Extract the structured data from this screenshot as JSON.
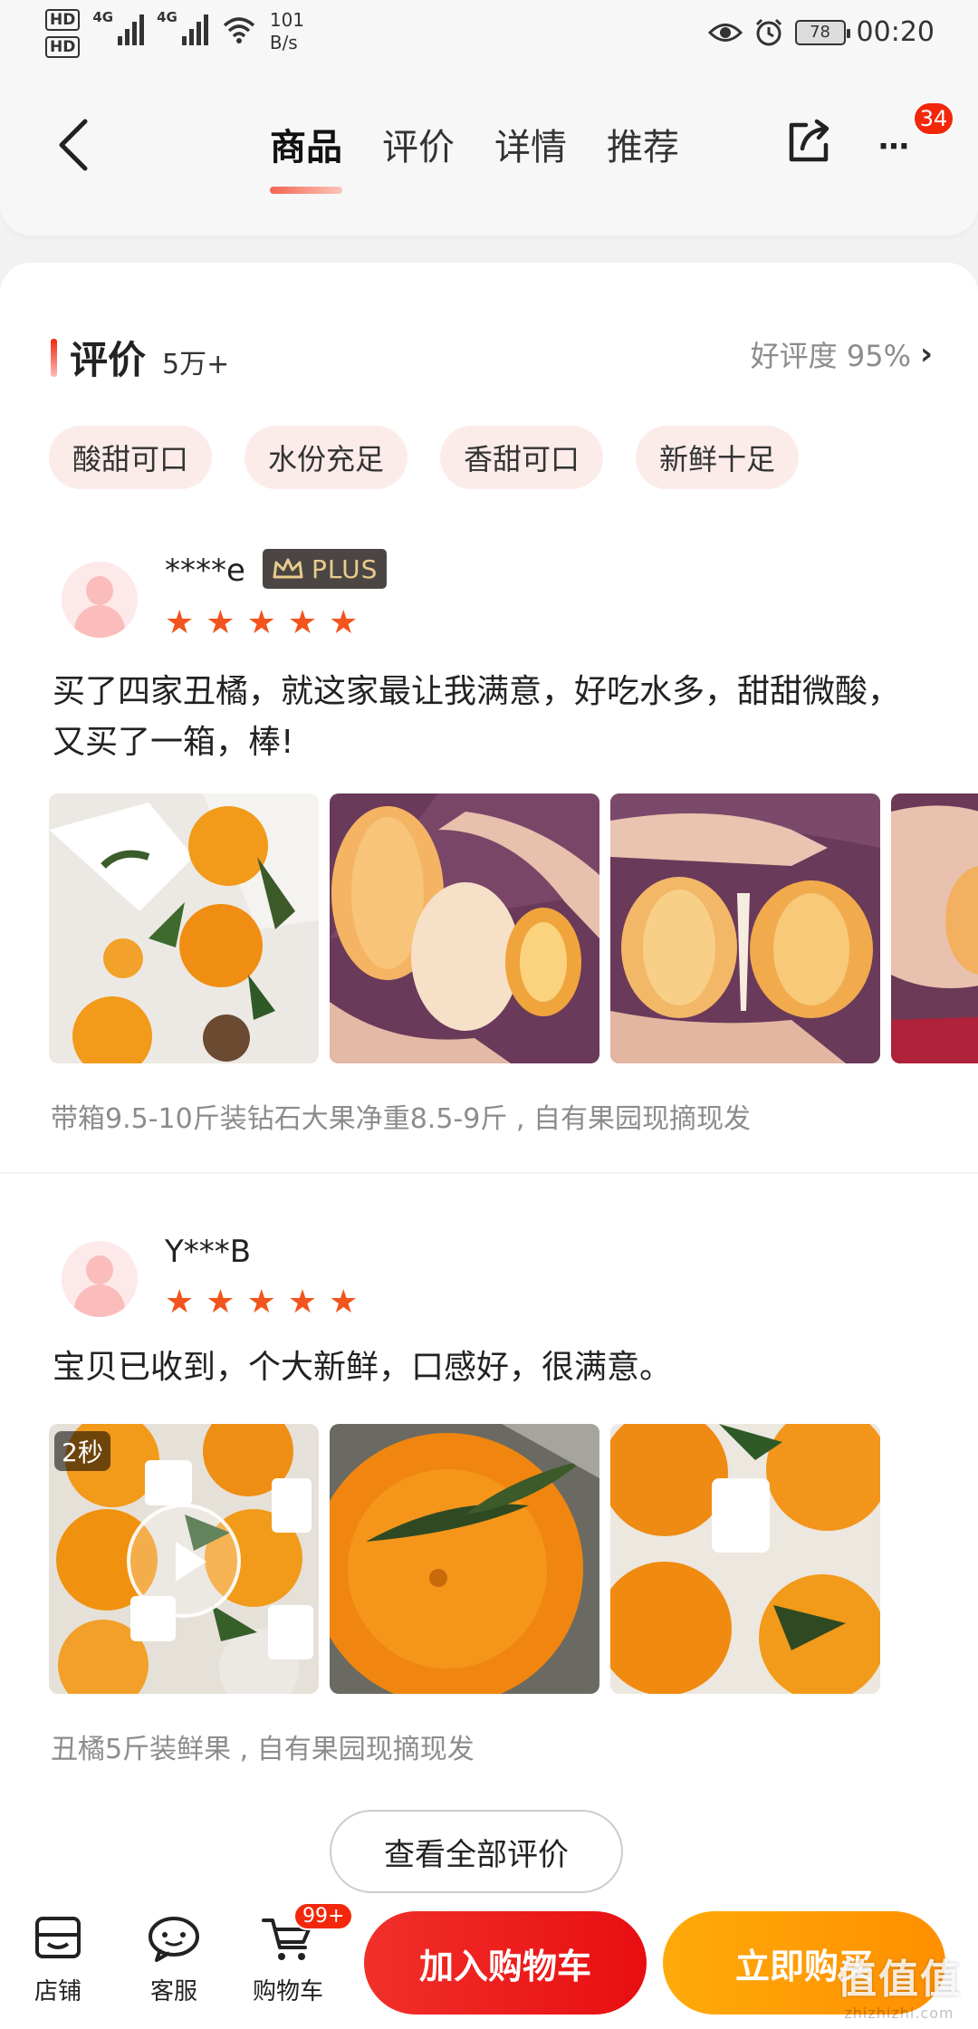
{
  "status_bar": {
    "hd1": "HD",
    "hd2": "HD",
    "net1": "4G",
    "net2": "4G",
    "speed_value": "101",
    "speed_unit": "B/s",
    "battery": "78",
    "time": "00:20"
  },
  "header": {
    "tabs": [
      {
        "label": "商品",
        "active": true
      },
      {
        "label": "评价",
        "active": false
      },
      {
        "label": "详情",
        "active": false
      },
      {
        "label": "推荐",
        "active": false
      }
    ],
    "more_icon": "⋯",
    "message_badge": "34"
  },
  "reviews_section": {
    "title": "评价",
    "count": "5万+",
    "good_rate": "好评度 95%",
    "tags": [
      "酸甜可口",
      "水份充足",
      "香甜可口",
      "新鲜十足"
    ],
    "reviews": [
      {
        "user": "****e",
        "plus_label": "PLUS",
        "stars": 5,
        "text": "买了四家丑橘，就这家最让我满意，好吃水多，甜甜微酸，又买了一箱，棒!",
        "spec": "带箱9.5-10斤装钻石大果净重8.5-9斤 , 自有果园现摘现发",
        "photo_count": 4
      },
      {
        "user": "Y***B",
        "stars": 5,
        "text": "宝贝已收到，个大新鲜，口感好，很满意。",
        "video_duration": "2秒",
        "spec": "丑橘5斤装鲜果 , 自有果园现摘现发",
        "photo_count": 3
      }
    ],
    "view_all": "查看全部评价"
  },
  "bottom_bar": {
    "store": "店铺",
    "service": "客服",
    "cart": "购物车",
    "cart_badge": "99+",
    "add_to_cart": "加入购物车",
    "buy_now": "立即购买"
  },
  "watermark": {
    "logo": "值值值",
    "url": "zhizhizhi.com"
  },
  "colors": {
    "accent_red": "#f2270c",
    "buy_orange": "#ff9f00",
    "star": "#f2541d",
    "tag_bg": "#fbecea"
  }
}
